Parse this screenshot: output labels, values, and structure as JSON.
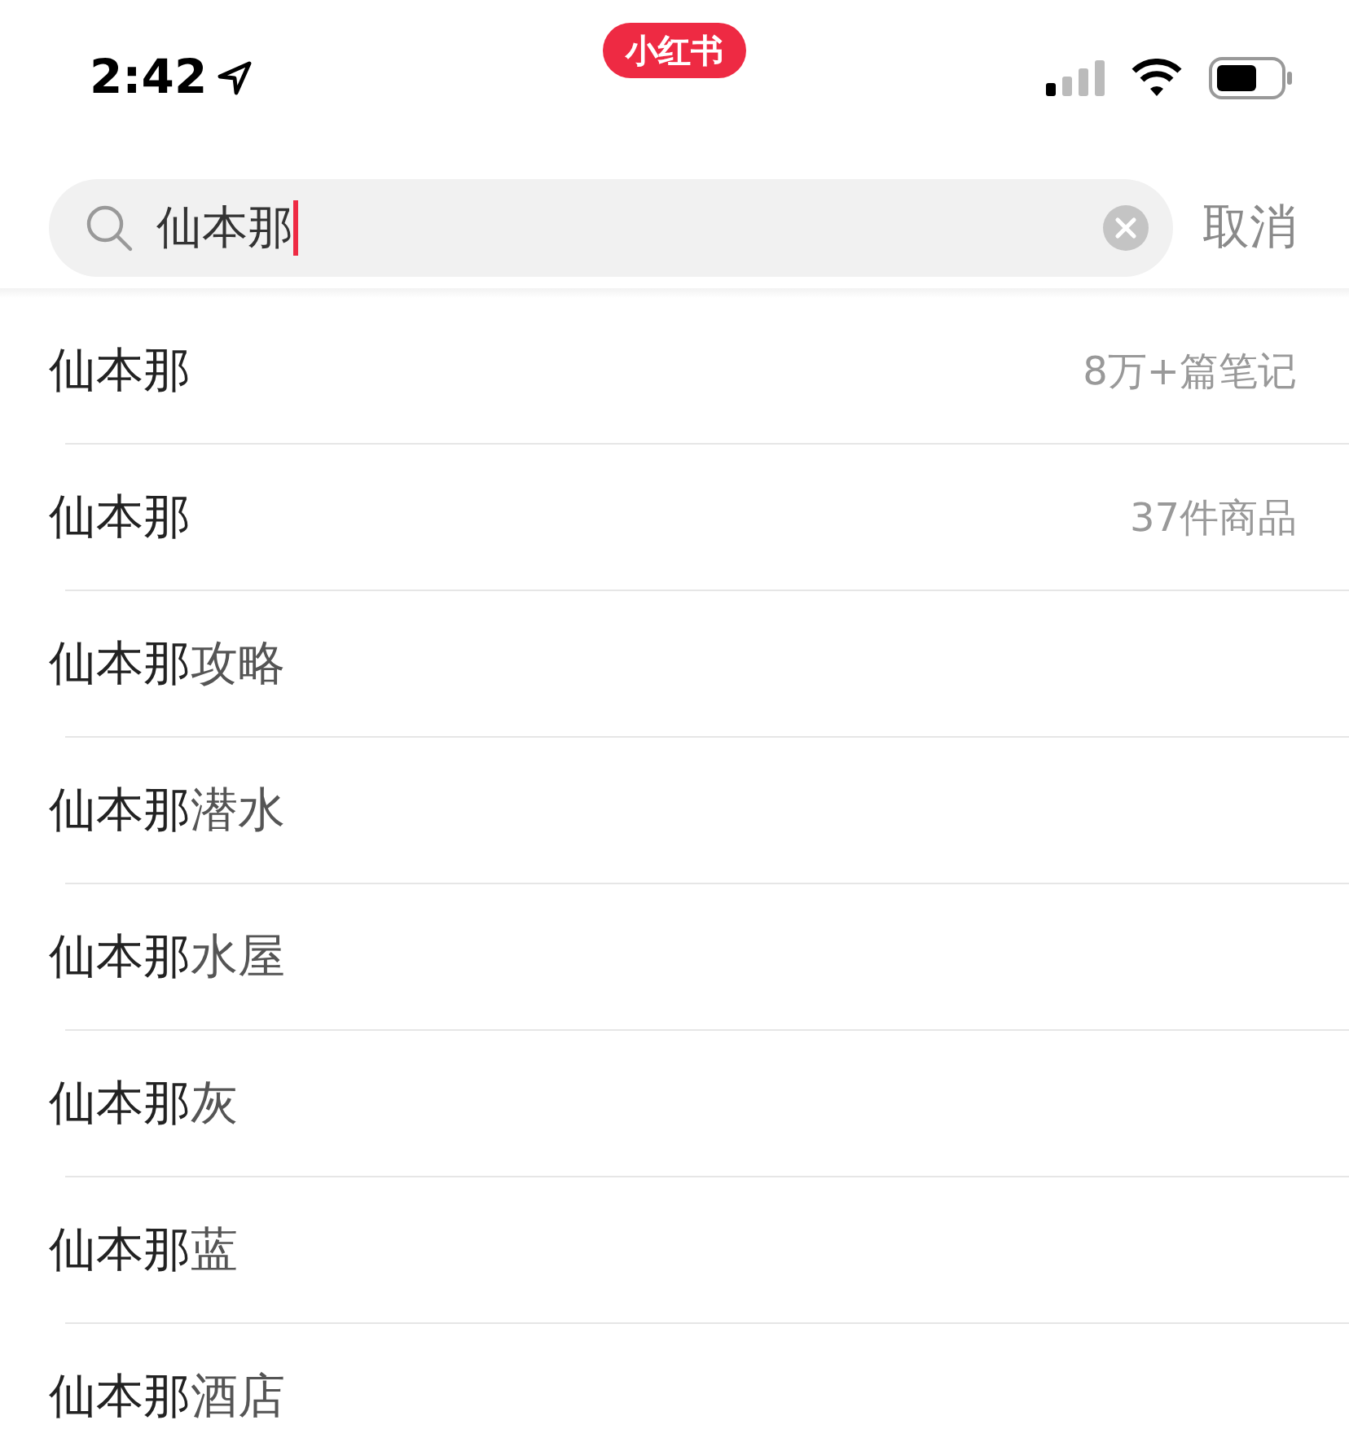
{
  "status_bar": {
    "time": "2:42",
    "app_badge": "小红书"
  },
  "search": {
    "value": "仙本那",
    "cancel": "取消"
  },
  "suggestions": [
    {
      "kind": "count",
      "text": "仙本那",
      "count": "8万+篇笔记"
    },
    {
      "kind": "count",
      "text": "仙本那",
      "count": "37件商品"
    },
    {
      "kind": "plain",
      "text": "**仙本那**攻略"
    },
    {
      "kind": "plain",
      "text": "**仙本那**潜水"
    },
    {
      "kind": "plain",
      "text": "**仙本那**水屋"
    },
    {
      "kind": "plain",
      "text": "**仙本那**灰"
    },
    {
      "kind": "plain",
      "text": "**仙本那**蓝"
    },
    {
      "kind": "plain",
      "text": "**仙本那**酒店"
    }
  ]
}
